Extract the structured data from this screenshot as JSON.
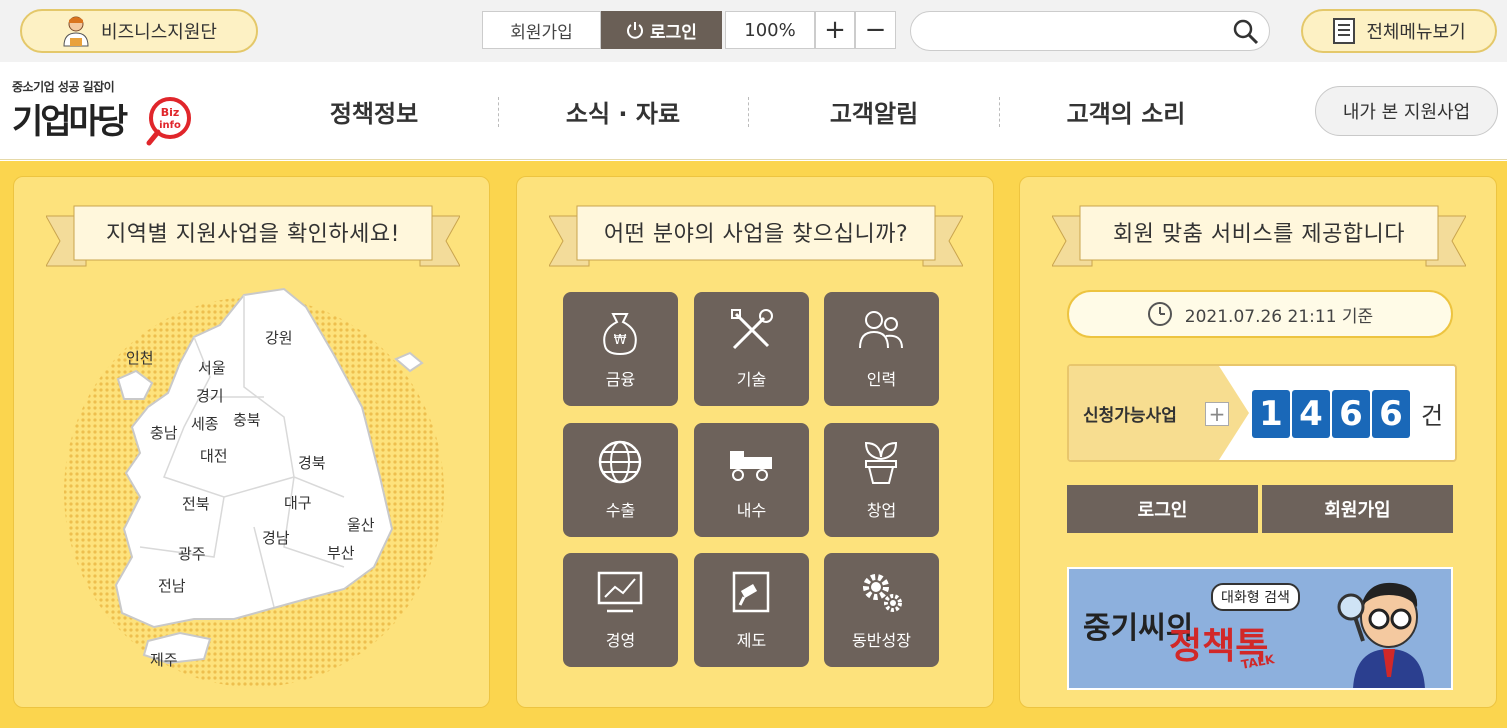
{
  "topbar": {
    "biz_support": "비즈니스지원단",
    "join": "회원가입",
    "login": "로그인",
    "zoom": "100%",
    "zoom_in": "+",
    "zoom_out": "−",
    "search_placeholder": "",
    "all_menu": "전체메뉴보기"
  },
  "logo": {
    "subtitle": "중소기업 성공 길잡이",
    "title": "기업마당",
    "badge_1": "Biz",
    "badge_2": "info"
  },
  "nav": {
    "items": [
      "정책정보",
      "소식 · 자료",
      "고객알림",
      "고객의 소리"
    ],
    "recent": "내가 본 지원사업"
  },
  "region_panel": {
    "title": "지역별 지원사업을 확인하세요!",
    "regions": [
      "강원",
      "인천",
      "서울",
      "경기",
      "세종",
      "충북",
      "충남",
      "대전",
      "경북",
      "전북",
      "대구",
      "경남",
      "울산",
      "부산",
      "광주",
      "전남",
      "제주"
    ]
  },
  "field_panel": {
    "title": "어떤 분야의 사업을 찾으십니까?",
    "fields": [
      "금융",
      "기술",
      "인력",
      "수출",
      "내수",
      "창업",
      "경영",
      "제도",
      "동반성장"
    ]
  },
  "member_panel": {
    "title": "회원 맞춤 서비스를 제공합니다",
    "date": "2021.07.26 21:11 기준",
    "count_label": "신청가능사업",
    "count_plus": "+",
    "count_digits": [
      "1",
      "4",
      "6",
      "6"
    ],
    "count_unit": "건",
    "login": "로그인",
    "join": "회원가입",
    "banner_pill": "대화형 검색",
    "banner_main": "중기씨의",
    "banner_title": "정책톡",
    "banner_talk": "TALK"
  },
  "colors": {
    "yellow_bg": "#fbd54e",
    "panel_bg": "#fde27c",
    "tile_bg": "#6d625b",
    "digit_blue": "#1a68b8"
  }
}
